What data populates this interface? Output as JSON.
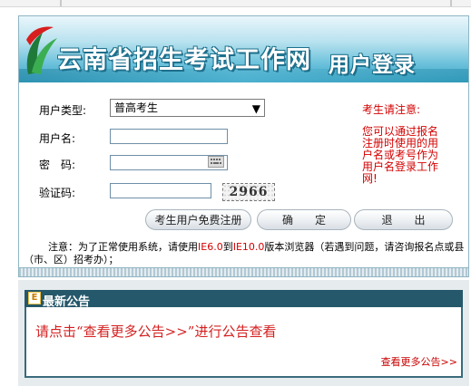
{
  "banner": {
    "title": "云南省招生考试工作网",
    "login_title": "用户登录"
  },
  "form": {
    "user_type_label": "用户类型:",
    "user_type_value": "普高考生",
    "username_label": "用户名:",
    "password_label": "密　码:",
    "captcha_label": "验证码:",
    "captcha_text": "2966"
  },
  "notice": {
    "title": "考生请注意:",
    "body": "您可以通过报名注册时使用的用户名或考号作为用户名登录工作网!"
  },
  "buttons": {
    "register": "考生用户免费注册",
    "confirm": "确　　定",
    "exit": "退　　出"
  },
  "tip": {
    "prefix": "注意：为了正常使用系统，请使用",
    "ie_low": "IE6.0",
    "to": "到",
    "ie_high": "IE10.0",
    "suffix": "版本浏览器（若遇到问题，请咨询报名点或县（市、区）招考办）；"
  },
  "announce": {
    "header": "最新公告",
    "message": "请点击“查看更多公告>>”进行公告查看",
    "more_link": "查看更多公告>>"
  },
  "colors": {
    "accent_red": "#d40000",
    "header_bg": "#25586a",
    "banner_blue": "#3aa6c9"
  }
}
